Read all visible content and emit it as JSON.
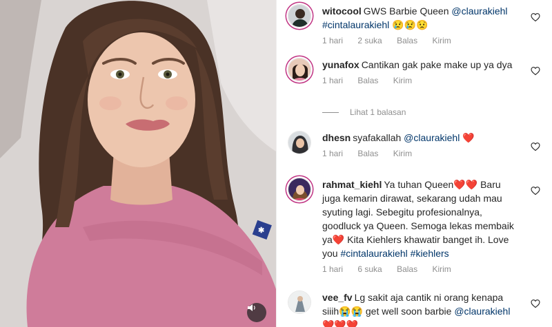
{
  "post": {
    "volume_icon": "volume-icon"
  },
  "comments": [
    {
      "username": "witocool",
      "text": "GWS Barbie Queen ",
      "mention": "@claurakiehl",
      "hashtags": "#cintalaurakiehl",
      "emoji": "😢😢😟",
      "time": "1 hari",
      "likes": "2 suka",
      "reply": "Balas",
      "send": "Kirim"
    },
    {
      "username": "yunafox",
      "text": "Cantikan gak pake make up ya dya",
      "time": "1 hari",
      "reply": "Balas",
      "send": "Kirim",
      "view_replies": "Lihat 1 balasan"
    },
    {
      "username": "dhesn",
      "text": "syafakallah ",
      "mention": "@claurakiehl",
      "emoji": "❤️",
      "time": "1 hari",
      "reply": "Balas",
      "send": "Kirim"
    },
    {
      "username": "rahmat_kiehl",
      "text_a": "Ya tuhan Queen",
      "emoji_a": "❤️❤️",
      "text_b": " Baru juga kemarin dirawat, sekarang udah mau syuting lagi. Sebegitu profesionalnya, goodluck ya Queen. Semoga lekas membaik ya",
      "emoji_b": "❤️",
      "text_c": " Kita Kiehlers khawatir banget ih. Love you ",
      "hashtag_1": "#cintalaurakiehl",
      "hashtag_2": "#kiehlers",
      "time": "1 hari",
      "likes": "6 suka",
      "reply": "Balas",
      "send": "Kirim"
    },
    {
      "username": "vee_fv",
      "text_a": "Lg sakit aja cantik ni orang kenapa siiih",
      "emoji_a": "😭😭",
      "text_b": " get well soon barbie ",
      "mention": "@claurakiehl",
      "emoji_b": " ❤️❤️❤️"
    }
  ],
  "colors": {
    "text": "#262626",
    "muted": "#8e8e8e",
    "link": "#003569",
    "story_ring": "#c13584",
    "heart_red": "#ed4956"
  }
}
